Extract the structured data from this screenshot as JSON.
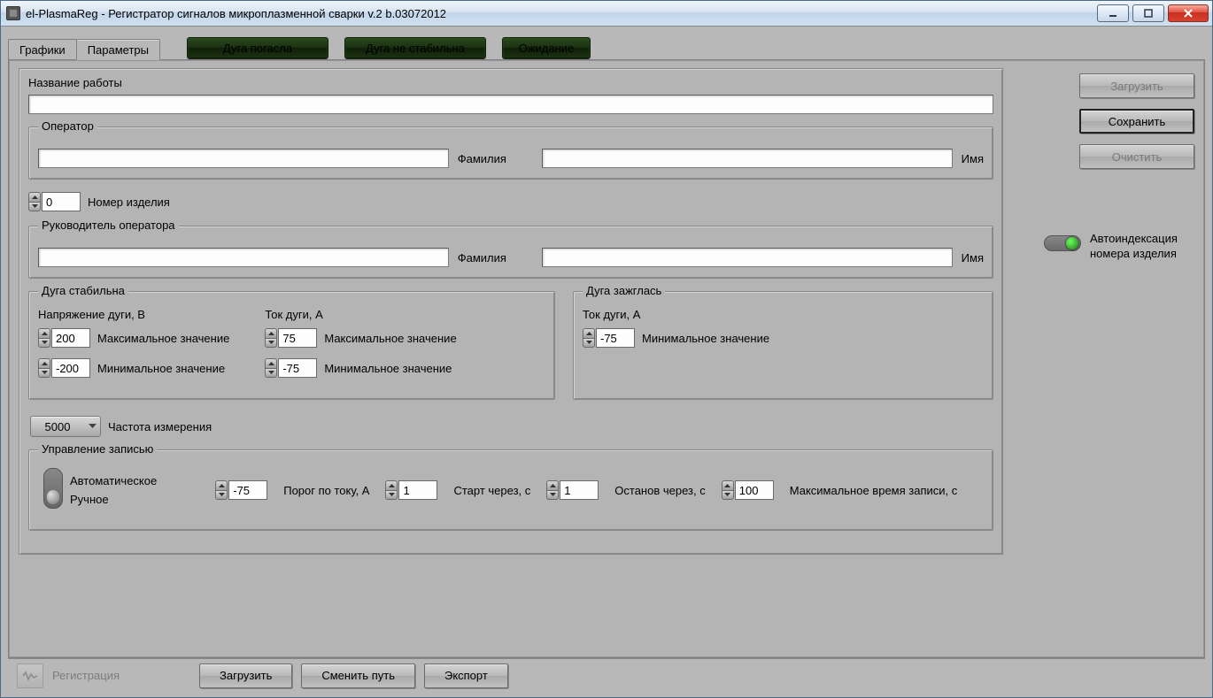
{
  "window": {
    "title": "el-PlasmaReg -  Регистратор сигналов микроплазменной сварки v.2 b.03072012"
  },
  "tabs": {
    "graphics": "Графики",
    "params": "Параметры"
  },
  "indicators": {
    "arc_off": "Дуга погасла",
    "arc_unstable": "Дуга не стабильна",
    "waiting": "Ожидание"
  },
  "side_buttons": {
    "load": "Загрузить",
    "save": "Сохранить",
    "clear": "Очистить"
  },
  "autoindex": {
    "label": "Автоиндексация номера изделия"
  },
  "job": {
    "label": "Название работы",
    "value": ""
  },
  "operator": {
    "legend": "Оператор",
    "surname_label": "Фамилия",
    "surname": "",
    "name_label": "Имя",
    "name": ""
  },
  "product_no": {
    "value": "0",
    "label": "Номер изделия"
  },
  "supervisor": {
    "legend": "Руководитель оператора",
    "surname_label": "Фамилия",
    "surname": "",
    "name_label": "Имя",
    "name": ""
  },
  "arc_stable": {
    "legend": "Дуга стабильна",
    "voltage_header": "Напряжение дуги, В",
    "current_header": "Ток дуги, А",
    "v_max": "200",
    "v_max_label": "Максимальное значение",
    "v_min": "-200",
    "v_min_label": "Минимальное значение",
    "i_max": "75",
    "i_max_label": "Максимальное значение",
    "i_min": "-75",
    "i_min_label": "Минимальное значение"
  },
  "arc_ignited": {
    "legend": "Дуга зажглась",
    "current_header": "Ток дуги, А",
    "i_min": "-75",
    "i_min_label": "Минимальное значение"
  },
  "freq": {
    "value": "5000",
    "label": "Частота измерения"
  },
  "record": {
    "legend": "Управление записью",
    "mode_auto": "Автоматическое",
    "mode_manual": "Ручное",
    "threshold": "-75",
    "threshold_label": "Порог по току, А",
    "start_after": "1",
    "start_after_label": "Старт через, с",
    "stop_after": "1",
    "stop_after_label": "Останов через, с",
    "max_time": "100",
    "max_time_label": "Максимальное время записи, с"
  },
  "bottom": {
    "registration": "Регистрация",
    "load": "Загрузить",
    "change_path": "Сменить путь",
    "export": "Экспорт"
  }
}
